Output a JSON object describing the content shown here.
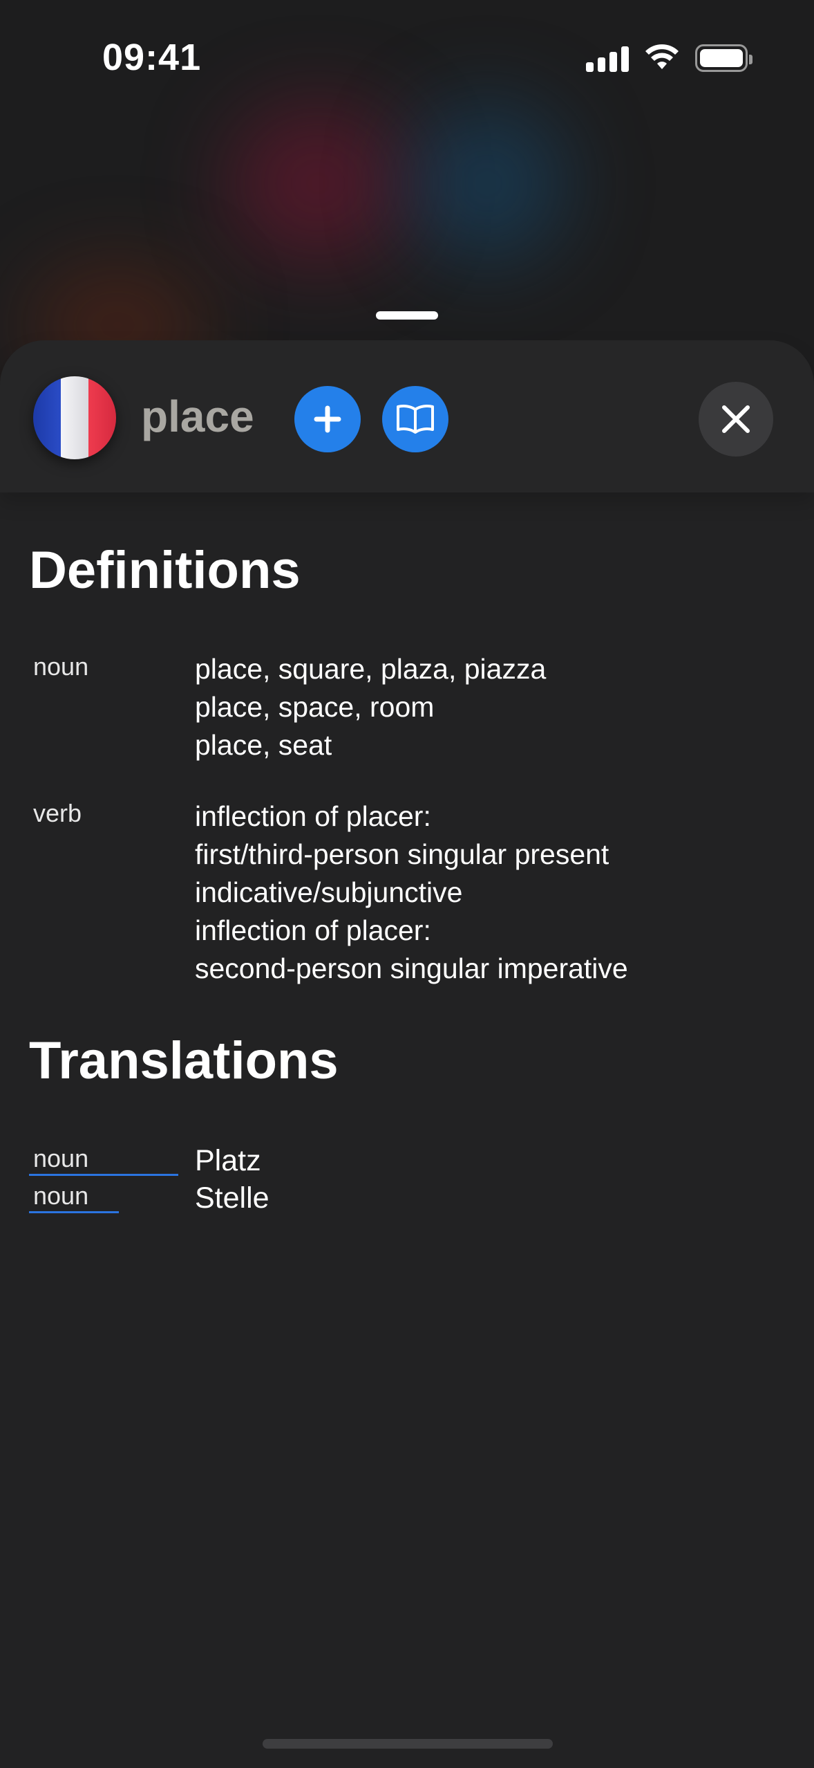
{
  "status_bar": {
    "time": "09:41",
    "signal_icon": "cellular-signal-icon",
    "wifi_icon": "wifi-icon",
    "battery_icon": "battery-icon"
  },
  "header": {
    "flag_icon": "france-flag-icon",
    "word": "place",
    "add_icon": "plus-icon",
    "book_icon": "open-book-icon",
    "close_icon": "close-icon",
    "accent_color": "#2480ea"
  },
  "definitions": {
    "title": "Definitions",
    "entries": [
      {
        "pos": "noun",
        "lines": [
          "place, square, plaza, piazza",
          "place, space, room",
          "place, seat"
        ]
      },
      {
        "pos": "verb",
        "lines": [
          "inflection of placer:",
          "first/third-person singular present",
          "indicative/subjunctive",
          "inflection of placer:",
          "second-person singular imperative"
        ]
      }
    ]
  },
  "translations": {
    "title": "Translations",
    "entries": [
      {
        "pos": "noun",
        "text": "Platz"
      },
      {
        "pos": "noun",
        "text": "Stelle"
      }
    ]
  }
}
